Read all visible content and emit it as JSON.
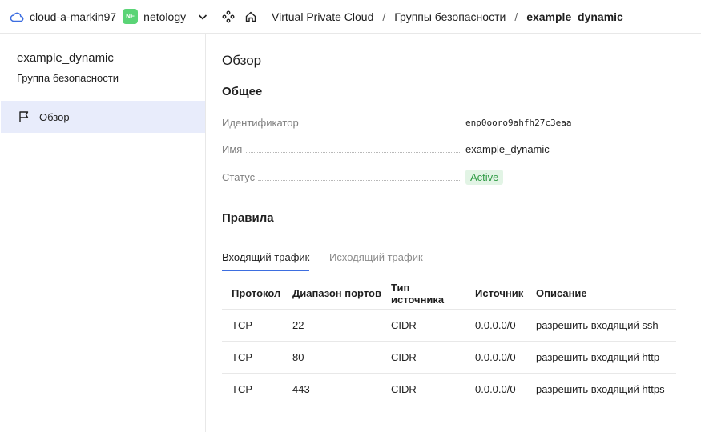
{
  "topbar": {
    "cloud_name": "cloud-a-markin97",
    "org_badge": "NE",
    "org_name": "netology",
    "breadcrumbs": [
      "Virtual Private Cloud",
      "Группы безопасности",
      "example_dynamic"
    ],
    "separator": "/"
  },
  "sidebar": {
    "title": "example_dynamic",
    "subtitle": "Группа безопасности",
    "items": [
      {
        "label": "Обзор",
        "icon": "flag-icon"
      }
    ]
  },
  "main": {
    "title": "Обзор",
    "general_title": "Общее",
    "props": [
      {
        "label": "Идентификатор",
        "value": "enp0ooro9ahfh27c3eaa"
      },
      {
        "label": "Имя",
        "value": "example_dynamic"
      },
      {
        "label": "Статус",
        "value": "Active"
      }
    ],
    "rules_title": "Правила",
    "tabs": [
      "Входящий трафик",
      "Исходящий трафик"
    ],
    "active_tab": "Входящий трафик",
    "table": {
      "headers": [
        "Протокол",
        "Диапазон портов",
        "Тип источника",
        "Источник",
        "Описание"
      ],
      "rows": [
        [
          "TCP",
          "22",
          "CIDR",
          "0.0.0.0/0",
          "разрешить входящий ssh"
        ],
        [
          "TCP",
          "80",
          "CIDR",
          "0.0.0.0/0",
          "разрешить входящий http"
        ],
        [
          "TCP",
          "443",
          "CIDR",
          "0.0.0.0/0",
          "разрешить входящий https"
        ]
      ]
    }
  },
  "colors": {
    "accent": "#3d6ee0",
    "selected_bg": "#e8ecfb",
    "status_bg": "#e2f4e5",
    "status_text": "#2f9b44",
    "org_badge_bg": "#5ad476"
  }
}
